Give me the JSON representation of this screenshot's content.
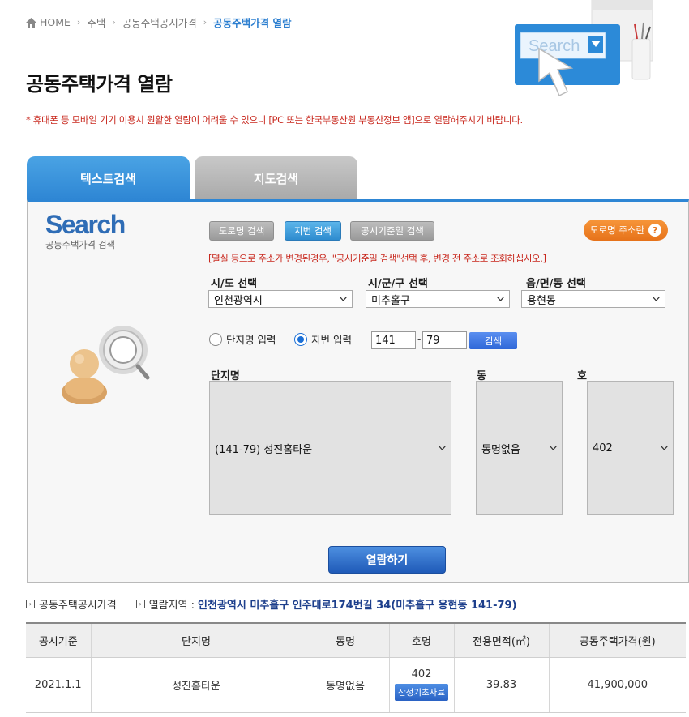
{
  "breadcrumb": {
    "home": "HOME",
    "items": [
      "주택",
      "공동주택공시가격",
      "공동주택가격 열람"
    ]
  },
  "page_title": "공동주택가격 열람",
  "notice": "* 휴대폰 등 모바일 기기 이용시 원활한 열람이 어려울 수 있으니 [PC 또는 한국부동산원 부동산정보 앱]으로 열람해주시기 바랍니다.",
  "hero": {
    "search_text": "Search"
  },
  "tabs": [
    {
      "label": "텍스트검색",
      "active": true
    },
    {
      "label": "지도검색",
      "active": false
    }
  ],
  "search_logo": {
    "word": "Search",
    "sub": "공동주택가격 검색"
  },
  "mode_buttons": [
    {
      "label": "도로명 검색",
      "active": false
    },
    {
      "label": "지번 검색",
      "active": true
    },
    {
      "label": "공시기준일 검색",
      "active": false
    }
  ],
  "road_guide": {
    "label": "도로명 주소란",
    "icon": "?"
  },
  "panel_notice": "[멸실 등으로 주소가 변경된경우, \"공시기준일 검색\"선택 후, 변경 전 주소로 조회하십시오.]",
  "selects": [
    {
      "label": "시/도 선택",
      "value": "인천광역시"
    },
    {
      "label": "시/군/구 선택",
      "value": "미추홀구"
    },
    {
      "label": "읍/면/동 선택",
      "value": "용현동"
    }
  ],
  "radios": [
    {
      "label": "단지명 입력",
      "checked": false
    },
    {
      "label": "지번 입력",
      "checked": true
    }
  ],
  "lot_number": {
    "main": "141",
    "sub": "79"
  },
  "search_button": "검색",
  "lists": [
    {
      "label": "단지명",
      "value": "(141-79) 성진홈타운"
    },
    {
      "label": "동",
      "value": "동명없음"
    },
    {
      "label": "호",
      "value": "402"
    }
  ],
  "view_button": "열람하기",
  "info": {
    "section": "공동주택공시가격",
    "region_label": "열람지역 :",
    "region_value": "인천광역시 미추홀구 인주대로174번길 34(미추홀구 용현동 141-79)"
  },
  "table": {
    "headers": [
      "공시기준",
      "단지명",
      "동명",
      "호명",
      "전용면적(㎡)",
      "공동주택가격(원)"
    ],
    "rows": [
      {
        "date": "2021.1.1",
        "complex": "성진홈타운",
        "dong": "동명없음",
        "ho": "402",
        "ho_button": "산정기초자료",
        "area": "39.83",
        "price": "41,900,000"
      }
    ]
  },
  "colors": {
    "accent_blue": "#2e86d4",
    "notice_red": "#c8281e",
    "region_navy": "#1d3f8c",
    "orange": "#e6721a"
  }
}
